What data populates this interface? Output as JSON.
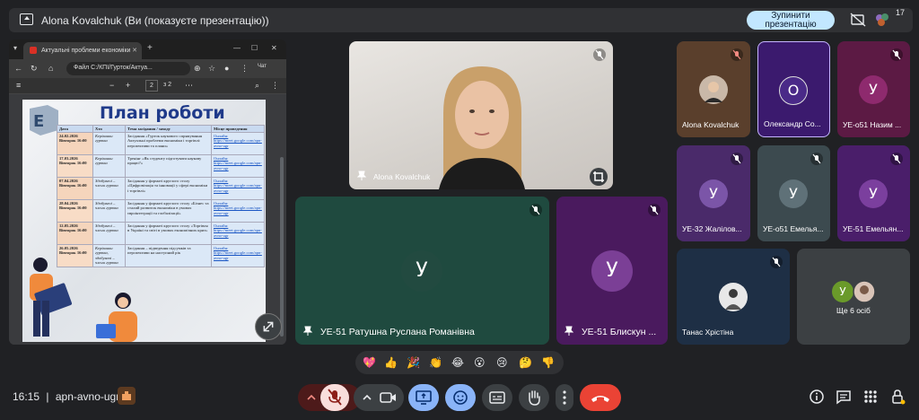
{
  "topbar": {
    "title": "Alona Kovalchuk (Ви (показуєте презентацію))",
    "stop_label_1": "Зупинити",
    "stop_label_2": "презентацію",
    "participants_count": "17"
  },
  "browser": {
    "tab_title": "Актуальні проблеми економіки",
    "address": "Файл   C:/КПІ/Гурток/Актуа...",
    "chat_label": "Чат",
    "page_number": "2",
    "page_total": "з 2"
  },
  "slide": {
    "title": "План роботи",
    "headers": [
      "Дата",
      "Хто",
      "Тема засідання / заходу",
      "Місце проведення"
    ],
    "rows": [
      [
        "24.02.2026 Вівторок 16:00",
        "Керівники гуртка",
        "Засідання «Гурток наукового спрямування Актуальні проблеми економіки і торгівлі: перспективи та плани»",
        "Онлайн: https://meet.google.com/apn-avno-ugr"
      ],
      [
        "17.03.2026 Вівторок 16:00",
        "Керівники гуртка",
        "Тренінг «Як студенту підготувати наукову працю?»",
        "Онлайн: https://meet.google.com/apn-avno-ugr"
      ],
      [
        "07.04.2026 Вівторок 16:00",
        "Здобувачі – члени гуртка",
        "Засідання у форматі круглого столу «Цифровізація та інновації у сфері економіки і торгівлі»",
        "Онлайн: https://meet.google.com/apn-avno-ugr"
      ],
      [
        "28.04.2026 Вівторок 16:00",
        "Здобувачі – члени гуртка",
        "Засідання у форматі круглого столу «Бізнес та сталий розвиток економіки в умовах євроінтеграції та глобалізації»",
        "Онлайн: https://meet.google.com/apn-avno-ugr"
      ],
      [
        "12.05.2026 Вівторок 16:00",
        "Здобувачі – члени гуртка",
        "Засідання у форматі круглого столу «Торгівля в Україні та світі в умовах економічних криз»",
        "Онлайн: https://meet.google.com/apn-avno-ugr"
      ],
      [
        "26.05.2026 Вівторок 16:00",
        "Керівники гуртка, здобувачі – члени гуртка",
        "Засідання – підведення підсумків та перспективи на наступний рік",
        "Онлайн: https://meet.google.com/apn-avno-ugr"
      ]
    ]
  },
  "tiles": {
    "main_speaker": "Alona Kovalchuk",
    "big1_name": "УЕ-51 Ратушна Руслана Романівна",
    "big1_initial": "У",
    "big2_name": "УЕ-51 Блискун ...",
    "big2_initial": "У",
    "small": [
      {
        "name": "Alona Kovalchuk",
        "initial": ""
      },
      {
        "name": "Олександр Со...",
        "initial": "О"
      },
      {
        "name": "УЕ-о51 Назим ...",
        "initial": "У"
      },
      {
        "name": "УЕ-32 Жалілов...",
        "initial": "У"
      },
      {
        "name": "УЕ-о51 Емелья...",
        "initial": "У"
      },
      {
        "name": "УЕ-51 Емельян...",
        "initial": "У"
      },
      {
        "name": "Танас Хрістіна",
        "initial": ""
      }
    ],
    "others_label": "Ще 6 осіб",
    "others_initial": "У"
  },
  "reactions": [
    "💖",
    "👍",
    "🎉",
    "👏",
    "😂",
    "😮",
    "😢",
    "🤔",
    "👎"
  ],
  "bottom": {
    "time": "16:15",
    "meeting_code": "apn-avno-ugr"
  },
  "colors": {
    "background": "#202124",
    "stop_button": "#c2e7ff",
    "end_call": "#ea4335",
    "green_tile": "#1f4a3f",
    "purple_tile": "#4a1a5e",
    "accent_blue": "#8ab4f8"
  }
}
